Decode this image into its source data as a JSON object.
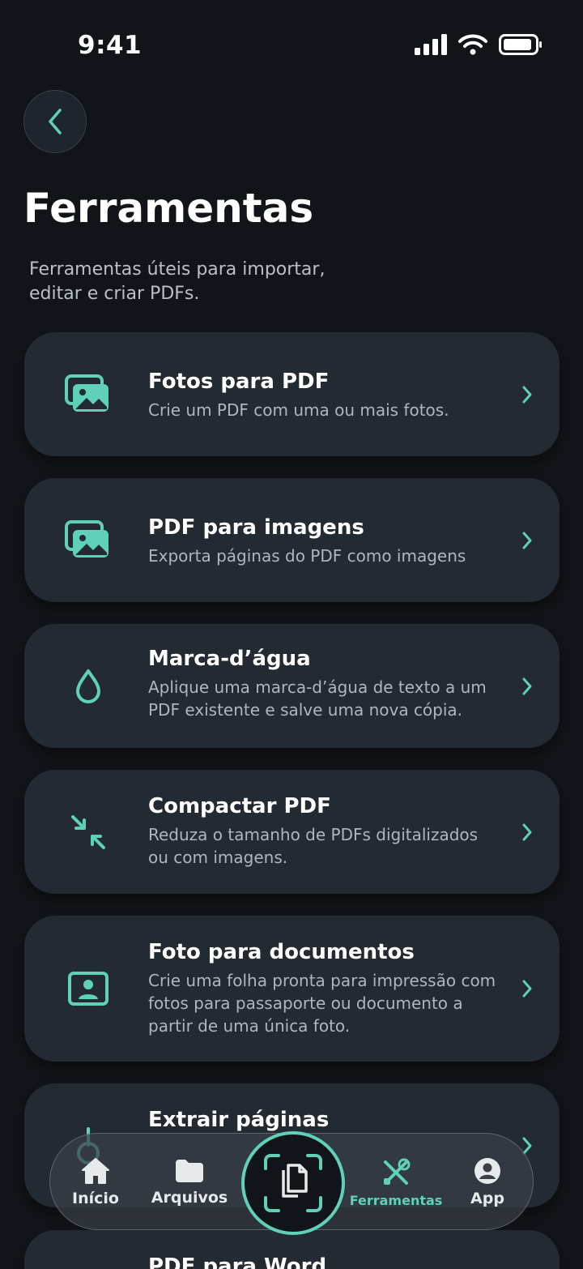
{
  "status_bar": {
    "time": "9:41"
  },
  "header": {
    "title": "Ferramentas",
    "subtitle": "Ferramentas úteis para importar, editar e criar PDFs."
  },
  "colors": {
    "accent": "#5fd1b9",
    "background": "#111418",
    "card": "#232a31"
  },
  "tools": [
    {
      "title": "Fotos para PDF",
      "description": "Crie um PDF com uma ou mais fotos.",
      "icon": "photos-icon"
    },
    {
      "title": "PDF para imagens",
      "description": "Exporta páginas do PDF como imagens",
      "icon": "images-icon"
    },
    {
      "title": "Marca-d’água",
      "description": "Aplique uma marca-d’água de texto a um PDF existente e salve uma nova cópia.",
      "icon": "droplet-icon"
    },
    {
      "title": "Compactar PDF",
      "description": "Reduza o tamanho de PDFs digitalizados ou com imagens.",
      "icon": "compress-icon"
    },
    {
      "title": "Foto para documentos",
      "description": "Crie uma folha pronta para impressão com fotos para passaporte ou documento a partir de uma única foto.",
      "icon": "id-photo-icon"
    },
    {
      "title": "Extrair páginas",
      "description": "",
      "icon": "extract-icon"
    },
    {
      "title": "PDF para Word",
      "description": "",
      "icon": "word-icon"
    }
  ],
  "tab_bar": {
    "tabs": [
      {
        "label": "Início",
        "icon": "home-icon"
      },
      {
        "label": "Arquivos",
        "icon": "folder-icon"
      },
      {
        "label": "Ferramentas",
        "icon": "tools-icon",
        "active": true
      },
      {
        "label": "App",
        "icon": "profile-icon"
      }
    ],
    "scan_icon": "scan-document-icon"
  }
}
